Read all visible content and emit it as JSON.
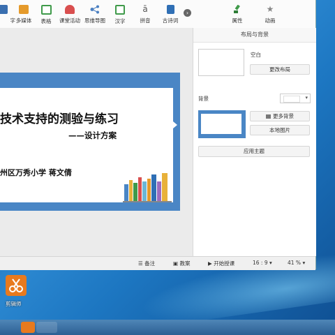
{
  "toolbar": {
    "items": [
      {
        "label": "字",
        "icon": "text-icon",
        "color": "#3a6fb0"
      },
      {
        "label": "多媒体",
        "icon": "multimedia-icon",
        "color": "#e59a2b"
      },
      {
        "label": "表格",
        "icon": "table-icon",
        "color": "#3f9a4a"
      },
      {
        "label": "课堂活动",
        "icon": "activity-icon",
        "color": "#d94f4f"
      },
      {
        "label": "思维导图",
        "icon": "mindmap-icon",
        "color": "#4a7fc1"
      },
      {
        "label": "汉字",
        "icon": "hanzi-icon",
        "color": "#3f9a4a"
      },
      {
        "label": "拼音",
        "icon": "pinyin-icon",
        "color": "#555555"
      },
      {
        "label": "古诗词",
        "icon": "poem-icon",
        "color": "#2f6fb5"
      }
    ],
    "right_items": [
      {
        "label": "属性",
        "icon": "paint-icon",
        "color": "#3f9a4a"
      },
      {
        "label": "动画",
        "icon": "star-icon",
        "color": "#888888"
      }
    ]
  },
  "panel": {
    "title": "布局与背景",
    "layout_name": "空白",
    "change_layout": "更改布局",
    "background_label": "背景",
    "more_backgrounds": "更多背景",
    "local_image": "本地图片",
    "apply_theme": "应用主题"
  },
  "slide": {
    "title": "技术支持的测验与练习",
    "subtitle": "——设计方案",
    "author": "州区万秀小学    蒋文倩"
  },
  "status": {
    "notes": "备注",
    "courseware": "教案",
    "start": "开始授课",
    "ratio": "16 : 9",
    "zoom": "41 %"
  },
  "desktop": {
    "shortcut_label": "剪辑师"
  },
  "colors": {
    "slide_border": "#4a86c5",
    "desktop": "#1f6fb3"
  }
}
